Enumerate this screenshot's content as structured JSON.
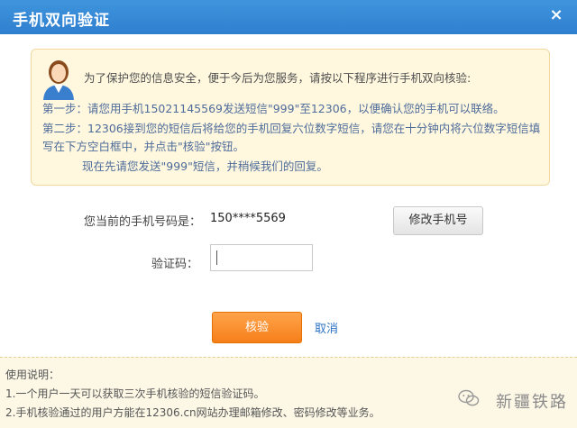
{
  "dialog": {
    "title": "手机双向验证",
    "close_glyph": "×"
  },
  "notice": {
    "intro": "为了保护您的信息安全，便于今后为您服务，请按以下程序进行手机双向核验:",
    "step1": "第一步：请您用手机15021145569发送短信\"999\"至12306，以便确认您的手机可以联络。",
    "step2": "第二步：12306接到您的短信后将给您的手机回复六位数字短信，请您在十分钟内将六位数字短信填写在下方空白框中，并点击\"核验\"按钮。",
    "note": "现在先请您发送\"999\"短信，并稍候我们的回复。",
    "avatar_icon": "user-avatar-icon"
  },
  "form": {
    "phone_label": "您当前的手机号码是：",
    "phone_value": "150****5569",
    "change_phone_label": "修改手机号",
    "code_label": "验证码：",
    "code_value": "",
    "code_placeholder": "",
    "verify_label": "核验",
    "cancel_label": "取消"
  },
  "usage": {
    "title": "使用说明：",
    "items": [
      "1.一个用户一天可以获取三次手机核验的短信验证码。",
      "2.手机核验通过的用户方能在12306.cn网站办理邮箱修改、密码修改等业务。"
    ]
  },
  "watermark": {
    "text": "新疆铁路",
    "icon": "wechat-icon"
  },
  "colors": {
    "titlebar": "#3189d6",
    "notice_bg": "#fff8df",
    "verify_button": "#f67f1a",
    "link": "#2d72c2"
  }
}
